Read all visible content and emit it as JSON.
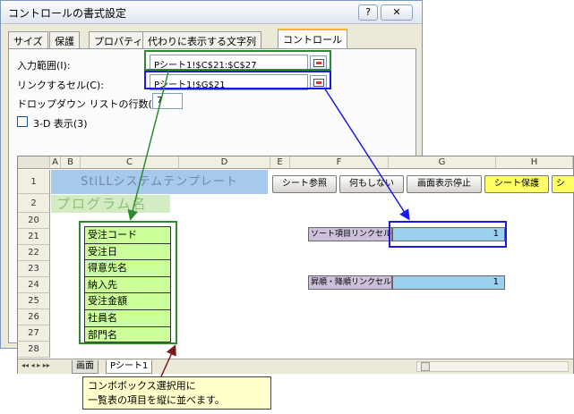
{
  "dialog": {
    "title": "コントロールの書式設定",
    "help_glyph": "?",
    "close_glyph": "✕",
    "tabs": [
      "サイズ",
      "保護",
      "プロパティ",
      "代わりに表示する文字列",
      "コントロール"
    ],
    "input_range_label": "入力範囲(I):",
    "input_range_value": "Pシート1!$C$21:$C$27",
    "link_cell_label": "リンクするセル(C):",
    "link_cell_value": "Pシート1!$G$21",
    "dropdown_rows_label": "ドロップダウン リストの行数(D):",
    "dropdown_rows_value": "7",
    "shading_3d_label": "3-D 表示(3)"
  },
  "sheet": {
    "columns": [
      "A",
      "B",
      "C",
      "D",
      "E",
      "F",
      "G",
      "H"
    ],
    "rows": [
      "1",
      "2",
      "20",
      "21",
      "22",
      "23",
      "24",
      "25",
      "26",
      "27",
      "28"
    ],
    "title_cell": "StiLLシステムテンプレート",
    "program_name": "プログラム名",
    "buttons": [
      "シート参照",
      "何もしない",
      "画面表示停止",
      "シート保護",
      "シ"
    ],
    "list_items": [
      "受注コード",
      "受注日",
      "得意先名",
      "納入先",
      "受注金額",
      "社員名",
      "部門名"
    ],
    "sort_link_label": "ソート項目リンクセル",
    "sort_link_value": "1",
    "order_link_label": "昇順・降順リンクセル",
    "order_link_value": "1",
    "sheet_tabs": [
      "画面",
      "Pシート1"
    ],
    "nav_glyphs": "◂◂ ◂ ▸ ▸▸"
  },
  "callout": {
    "line1": "コンボボックス選択用に",
    "line2": "一覧表の項目を縦に並べます。"
  },
  "colors": {
    "green_arrow": "#2d8a2d",
    "blue_arrow": "#1a1ae6",
    "dark_arrow": "#7a1a1a"
  }
}
